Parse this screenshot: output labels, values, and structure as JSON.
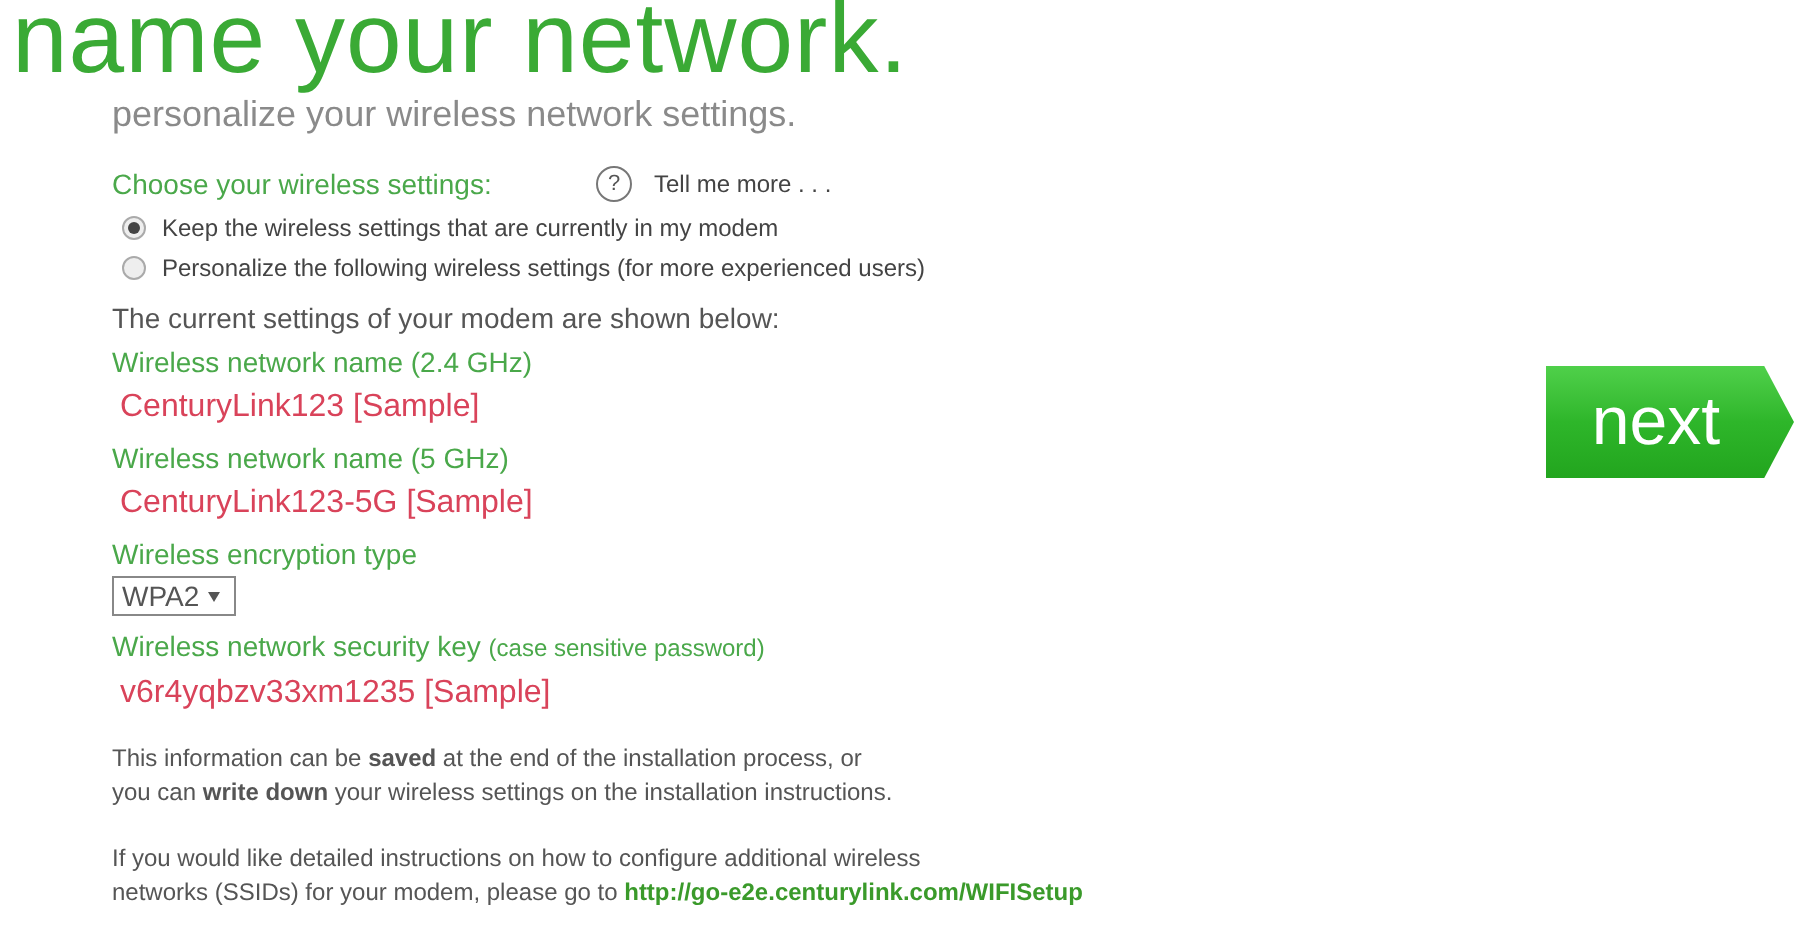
{
  "title": "name your network.",
  "subtitle": "personalize your wireless network settings.",
  "choose_label": "Choose your wireless settings:",
  "help": {
    "icon_text": "?",
    "label": "Tell me more . . ."
  },
  "options": [
    {
      "label": "Keep the wireless settings that are currently in my modem",
      "selected": true
    },
    {
      "label": "Personalize the following wireless settings (for more experienced users)",
      "selected": false
    }
  ],
  "current_intro": "The current settings of your modem are shown below:",
  "fields": [
    {
      "kind": "text",
      "label": "Wireless network name (2.4 GHz)",
      "value": "CenturyLink123 [Sample]"
    },
    {
      "kind": "text",
      "label": "Wireless network name (5 GHz)",
      "value": "CenturyLink123-5G [Sample]"
    },
    {
      "kind": "select",
      "label": "Wireless encryption type",
      "value": "WPA2"
    },
    {
      "kind": "text",
      "label": "Wireless network security key",
      "note": "(case sensitive password)",
      "value": "v6r4yqbzv33xm1235 [Sample]"
    }
  ],
  "info_lines": [
    "This information can be **saved** at the end of the installation process, or",
    "you can **write down** your wireless settings on the installation instructions."
  ],
  "instructions": {
    "lines": [
      "If you would like detailed instructions on how to configure additional wireless",
      "networks (SSIDs) for your modem, please go to"
    ],
    "link": "http://go-e2e.centurylink.com/WIFISetup"
  },
  "next_button": "next"
}
